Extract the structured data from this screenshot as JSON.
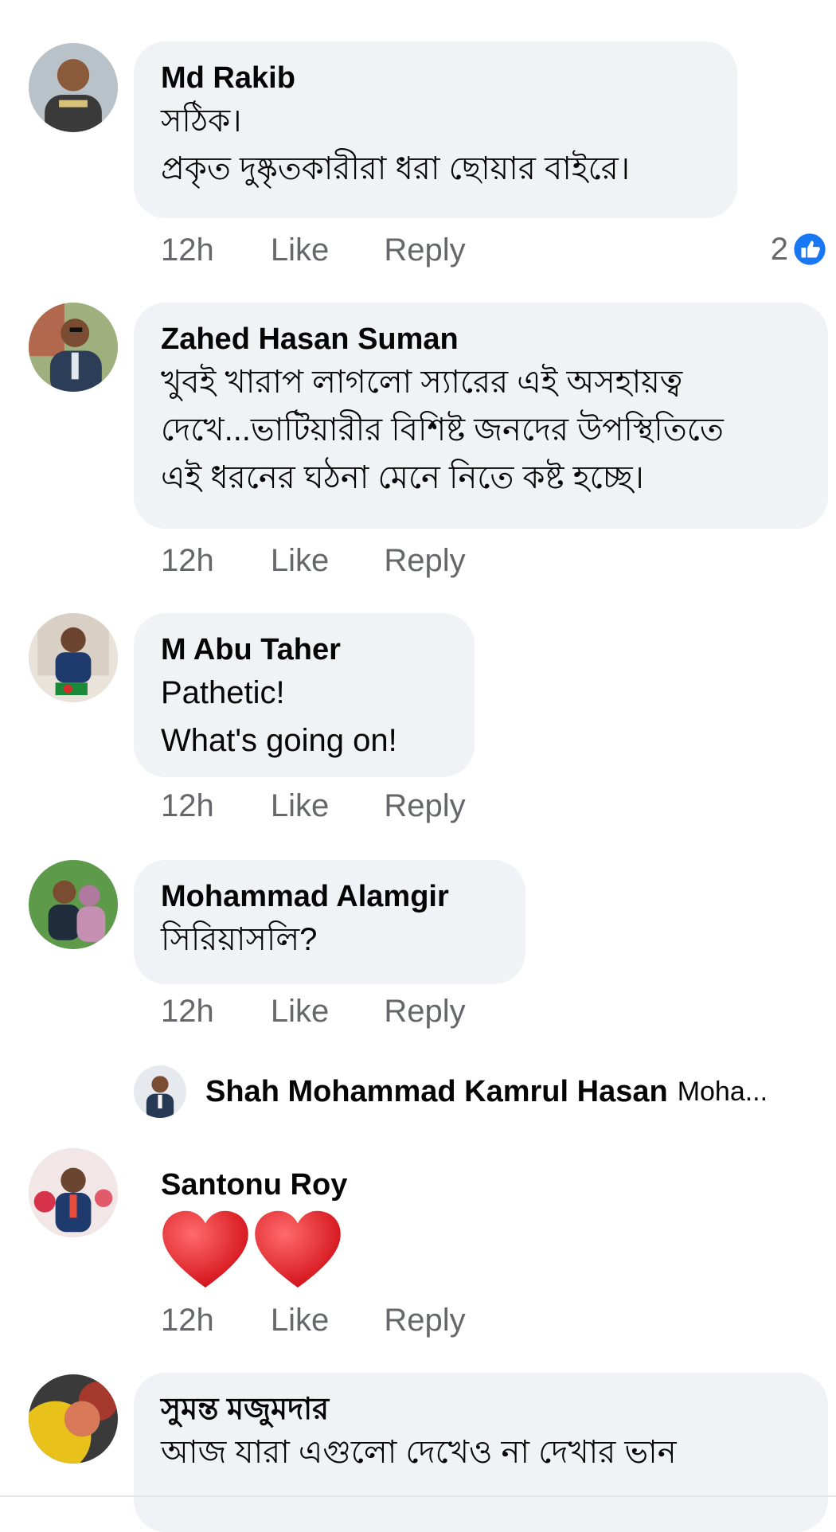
{
  "comments": [
    {
      "name": "Md Rakib",
      "lines": [
        "সঠিক।",
        "প্রকৃত দুষ্কৃতকারীরা ধরা ছোয়ার বাইরে।"
      ],
      "time": "12h",
      "like": "Like",
      "reply": "Reply",
      "reaction_count": "2"
    },
    {
      "name": "Zahed Hasan Suman",
      "lines": [
        "খুবই খারাপ লাগলো স্যারের এই অসহায়ত্ব",
        "দেখে...ভাটিয়ারীর বিশিষ্ট জনদের উপস্থিতিতে",
        "এই ধরনের ঘঠনা মেনে নিতে কষ্ট হচ্ছে।"
      ],
      "time": "12h",
      "like": "Like",
      "reply": "Reply"
    },
    {
      "name": "M Abu Taher",
      "lines": [
        "Pathetic!",
        "What's going on!"
      ],
      "time": "12h",
      "like": "Like",
      "reply": "Reply"
    },
    {
      "name": "Mohammad Alamgir",
      "lines": [
        "সিরিয়াসলি?"
      ],
      "time": "12h",
      "like": "Like",
      "reply": "Reply"
    },
    {
      "name": "Santonu Roy",
      "lines": [],
      "time": "12h",
      "like": "Like",
      "reply": "Reply"
    },
    {
      "name": "সুমন্ত মজুমদার",
      "lines": [
        "আজ যারা এগুলো দেখেও না দেখার ভান"
      ]
    }
  ],
  "reply_preview": {
    "name": "Shah Mohammad Kamrul Hasan",
    "text": "Moha..."
  },
  "colors": {
    "bubble": "#f0f2f5",
    "meta_text": "#65676b",
    "like_blue": "#1877f2",
    "heart_red": "#e0202a"
  },
  "icons": [
    "like-reaction-icon",
    "heart-emoji-icon"
  ]
}
